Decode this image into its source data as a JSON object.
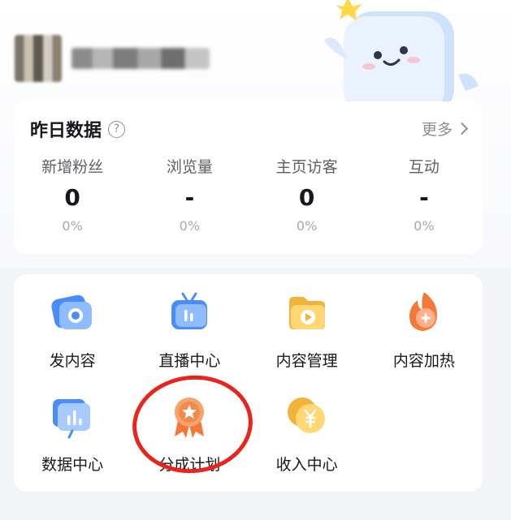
{
  "yesterday": {
    "title": "昨日数据",
    "more": "更多",
    "stats": [
      {
        "label": "新增粉丝",
        "value": "0",
        "pct": "0%"
      },
      {
        "label": "浏览量",
        "value": "-",
        "pct": "0%"
      },
      {
        "label": "主页访客",
        "value": "0",
        "pct": "0%"
      },
      {
        "label": "互动",
        "value": "-",
        "pct": "0%"
      }
    ]
  },
  "tools": [
    {
      "label": "发内容",
      "icon": "camera-icon"
    },
    {
      "label": "直播中心",
      "icon": "live-tv-icon"
    },
    {
      "label": "内容管理",
      "icon": "folder-play-icon"
    },
    {
      "label": "内容加热",
      "icon": "flame-plus-icon"
    },
    {
      "label": "数据中心",
      "icon": "bar-chart-icon"
    },
    {
      "label": "分成计划",
      "icon": "medal-star-icon"
    },
    {
      "label": "收入中心",
      "icon": "yen-coin-icon"
    }
  ],
  "colors": {
    "annotation": "#e8241c",
    "accent_blue": "#4a8df8",
    "accent_orange": "#f2783c",
    "accent_yellow": "#f7c440"
  }
}
